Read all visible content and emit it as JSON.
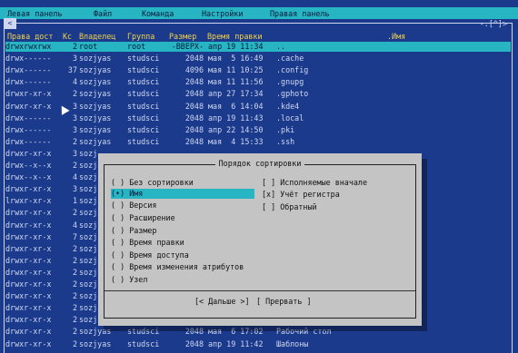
{
  "menu": [
    "Левая панель",
    "Файл",
    "Команда",
    "Настройки",
    "Правая панель"
  ],
  "panel": {
    "corner_glyph": "<",
    "indicator": "-.[^]>",
    "headers": [
      "Права дост",
      "Кс",
      "Владелец",
      "Группа",
      "Размер",
      "Время правки",
      ".Имя"
    ],
    "rows": [
      [
        "drwxrwxrwx",
        "2",
        "root",
        "root",
        "-ВВЕРХ-",
        "апр 19 11:34",
        ".."
      ],
      [
        "drwx------",
        "3",
        "sozjyas",
        "studsci",
        "2048",
        "мая  5 16:49",
        ".cache"
      ],
      [
        "drwx------",
        "37",
        "sozjyas",
        "studsci",
        "4096",
        "мая 11 10:25",
        ".config"
      ],
      [
        "drwx------",
        "4",
        "sozjyas",
        "studsci",
        "2048",
        "мая 11 11:56",
        ".gnupg"
      ],
      [
        "drwxr-xr-x",
        "2",
        "sozjyas",
        "studsci",
        "2048",
        "апр 27 17:34",
        ".gphoto"
      ],
      [
        "drwxr-xr-x",
        "3",
        "sozjyas",
        "studsci",
        "2048",
        "мая  6 14:04",
        ".kde4"
      ],
      [
        "drwx------",
        "3",
        "sozjyas",
        "studsci",
        "2048",
        "апр 19 11:43",
        ".local"
      ],
      [
        "drwx------",
        "3",
        "sozjyas",
        "studsci",
        "2048",
        "апр 22 14:50",
        ".pki"
      ],
      [
        "drwx------",
        "2",
        "sozjyas",
        "studsci",
        "2048",
        "мая  4 15:33",
        ".ssh"
      ],
      [
        "drwxr-xr-x",
        "3",
        "sozj",
        "",
        "",
        "",
        ""
      ],
      [
        "drwx--x--x",
        "2",
        "sozj",
        "",
        "",
        "",
        ""
      ],
      [
        "drwx--x--x",
        "4",
        "sozj",
        "",
        "",
        "",
        ""
      ],
      [
        "drwxr-xr-x",
        "3",
        "sozj",
        "",
        "",
        "",
        ""
      ],
      [
        "lrwxr-xr-x",
        "1",
        "sozj",
        "",
        "",
        "",
        ""
      ],
      [
        "drwxr-xr-x",
        "2",
        "sozj",
        "",
        "",
        "",
        ""
      ],
      [
        "drwxr-xr-x",
        "4",
        "sozj",
        "",
        "",
        "",
        ""
      ],
      [
        "drwxr-xr-x",
        "7",
        "sozj",
        "",
        "",
        "",
        ""
      ],
      [
        "drwxr-xr-x",
        "2",
        "sozj",
        "",
        "",
        "",
        ""
      ],
      [
        "drwxr-xr-x",
        "2",
        "sozj",
        "",
        "",
        "",
        ""
      ],
      [
        "drwxr-xr-x",
        "2",
        "sozj",
        "",
        "",
        "",
        ""
      ],
      [
        "drwxr-xr-x",
        "2",
        "sozj",
        "",
        "",
        "",
        ""
      ],
      [
        "drwxr-xr-x",
        "2",
        "sozj",
        "",
        "",
        "",
        ""
      ],
      [
        "drwxr-xr-x",
        "2",
        "sozj",
        "",
        "",
        "",
        ""
      ],
      [
        "drwxr-xr-x",
        "2",
        "sozj",
        "",
        "",
        "",
        ""
      ],
      [
        "drwxr-xr-x",
        "2",
        "sozjyas",
        "studsci",
        "2048",
        "мая  6 17:02",
        "Рабочий стол"
      ],
      [
        "drwxr-xr-x",
        "2",
        "sozjyas",
        "studsci",
        "2048",
        "апр 19 11:42",
        "Шаблоны"
      ]
    ]
  },
  "dialog": {
    "title": "Порядок сортировки",
    "sort_options": [
      {
        "mark": "( )",
        "label": "Без сортировки"
      },
      {
        "mark": "(•)",
        "label": "Имя"
      },
      {
        "mark": "( )",
        "label": "Версия"
      },
      {
        "mark": "( )",
        "label": "Расширение"
      },
      {
        "mark": "( )",
        "label": "Размер"
      },
      {
        "mark": "( )",
        "label": "Время правки"
      },
      {
        "mark": "( )",
        "label": "Время доступа"
      },
      {
        "mark": "( )",
        "label": "Время изменения атрибутов"
      },
      {
        "mark": "( )",
        "label": "Узел"
      }
    ],
    "checkboxes": [
      {
        "mark": "[ ]",
        "label": "Исполняемые вначале"
      },
      {
        "mark": "[x]",
        "label": "Учёт регистра"
      },
      {
        "mark": "[ ]",
        "label": "Обратный"
      }
    ],
    "ok_button": "[< Дальше >]",
    "cancel_button": "[ Прервать ]"
  }
}
